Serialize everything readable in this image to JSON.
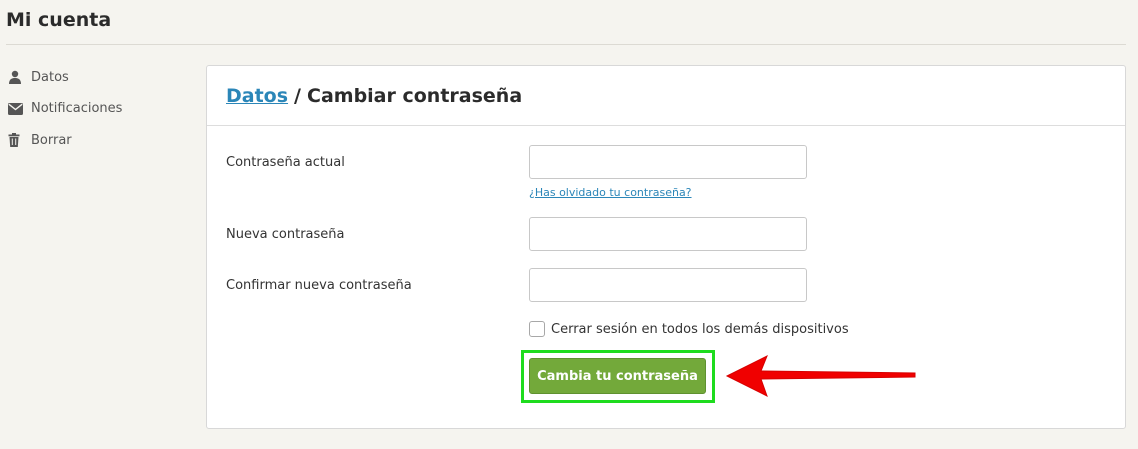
{
  "header": {
    "title": "Mi cuenta"
  },
  "sidebar": {
    "items": [
      {
        "icon": "user-icon",
        "label": "Datos"
      },
      {
        "icon": "envelope-icon",
        "label": "Notificaciones"
      },
      {
        "icon": "trash-icon",
        "label": "Borrar"
      }
    ]
  },
  "card": {
    "breadcrumb_link": "Datos",
    "breadcrumb_separator": "/",
    "title": "Cambiar contraseña"
  },
  "form": {
    "current_password_label": "Contraseña actual",
    "current_password_value": "",
    "forgot_link": "¿Has olvidado tu contraseña?",
    "new_password_label": "Nueva contraseña",
    "new_password_value": "",
    "confirm_password_label": "Confirmar nueva contraseña",
    "confirm_password_value": "",
    "logout_checkbox_label": "Cerrar sesión en todos los demás dispositivos",
    "logout_checkbox_checked": false,
    "submit_label": "Cambia tu contraseña"
  },
  "annotations": {
    "highlight_color": "#1edc1e",
    "arrow_color": "#f00000"
  },
  "colors": {
    "link": "#2b86b8",
    "button": "#73a93a",
    "background": "#f5f4ef"
  }
}
